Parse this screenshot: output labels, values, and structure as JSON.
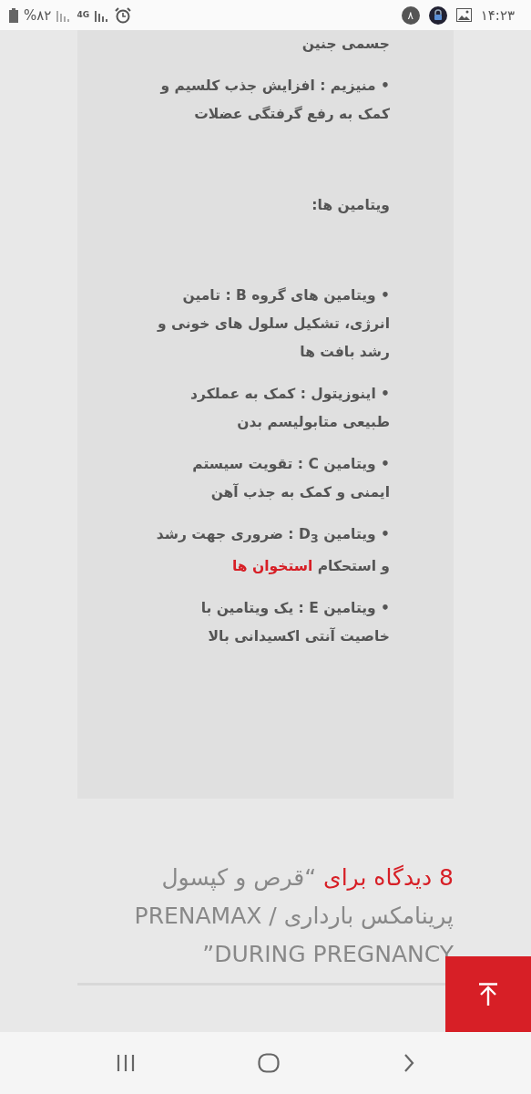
{
  "status_bar": {
    "battery": "%۸۲",
    "network": "4G",
    "notification_count": "۸",
    "time": "۱۴:۲۳"
  },
  "article": {
    "paragraphs": [
      {
        "kind": "text",
        "text": "جسمی جنین"
      },
      {
        "kind": "bullet",
        "text": "• منیزیم : افزایش جذب کلسیم و کمک به رفع گرفتگی عضلات"
      },
      {
        "kind": "heading",
        "text": "ویتامین ها:"
      },
      {
        "kind": "bullet",
        "text": "• ویتامین های گروه B : تامین انرژی، تشکیل سلول های خونی و رشد بافت ها"
      },
      {
        "kind": "bullet",
        "text": "• اینوزیتول : کمک به عملکرد طبیعی متابولیسم بدن"
      },
      {
        "kind": "bullet",
        "text": "• ویتامین C : تقویت سیستم ایمنی و کمک به جذب آهن"
      },
      {
        "kind": "bullet",
        "text": "• ویتامین D$_{3}$ : ضروری جهت رشد و استحکام",
        "link": "استخوان ها"
      },
      {
        "kind": "bullet",
        "text": "• ویتامین E : یک ویتامین با خاصیت آنتی اکسیدانی بالا"
      }
    ]
  },
  "comments": {
    "count_label": "8 دیدگاه برای",
    "title": "“قرص و کپسول پرینامکس بارداری / PRENAMAX DURING PREGNANCY”"
  }
}
